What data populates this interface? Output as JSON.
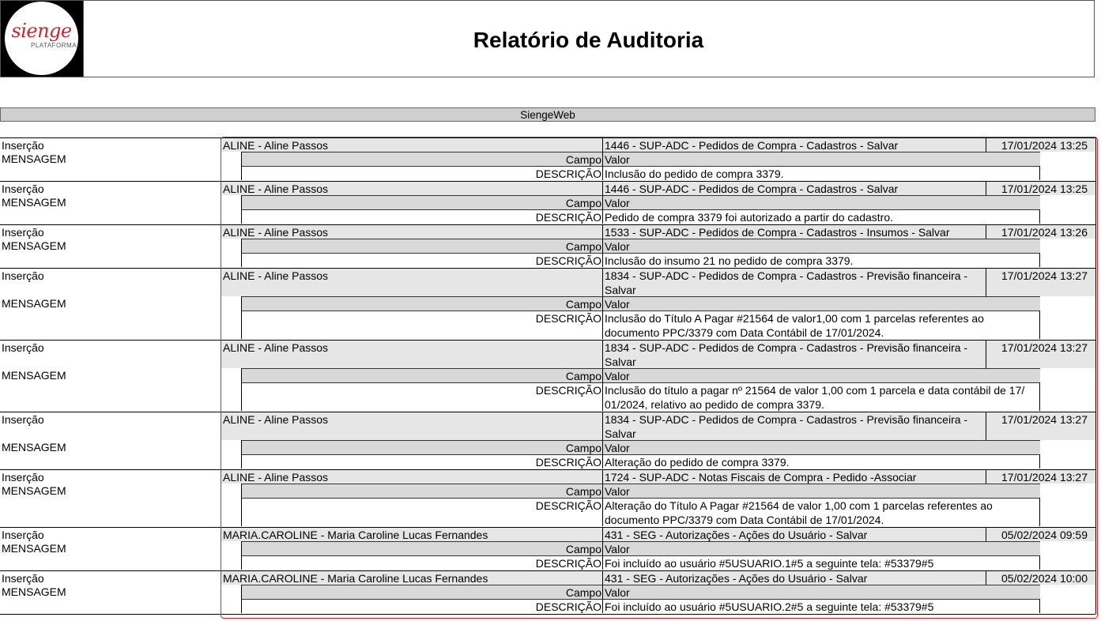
{
  "header": {
    "logo_text": "sienge",
    "logo_sub": "PLATAFORMA",
    "title": "Relatório de Auditoria"
  },
  "section_title": "SiengeWeb",
  "labels": {
    "type_label": "Inserção",
    "msg_label": "MENSAGEM",
    "campo": "Campo",
    "valor": "Valor",
    "descricao": "DESCRIÇÃO"
  },
  "records": [
    {
      "user": "ALINE - Aline Passos",
      "action": [
        "1446 - SUP-ADC - Pedidos de Compra - Cadastros - Salvar"
      ],
      "datetime": "17/01/2024 13:25",
      "desc": [
        "Inclusão do pedido de compra 3379."
      ]
    },
    {
      "user": "ALINE - Aline Passos",
      "action": [
        "1446 - SUP-ADC - Pedidos de Compra - Cadastros - Salvar"
      ],
      "datetime": "17/01/2024 13:25",
      "desc": [
        "Pedido de compra 3379 foi autorizado a partir do cadastro."
      ]
    },
    {
      "user": "ALINE - Aline Passos",
      "action": [
        "1533 - SUP-ADC - Pedidos de Compra - Cadastros - Insumos - Salvar"
      ],
      "datetime": "17/01/2024 13:26",
      "desc": [
        "Inclusão do insumo 21 no pedido de compra 3379."
      ]
    },
    {
      "user": "ALINE - Aline Passos",
      "action": [
        "1834 - SUP-ADC - Pedidos de Compra - Cadastros - Previsão financeira -",
        "Salvar"
      ],
      "datetime": "17/01/2024 13:27",
      "desc": [
        "Inclusão do Título A Pagar #21564 de valor1,00 com 1 parcelas referentes ao",
        "documento PPC/3379 com Data Contábil de 17/01/2024."
      ]
    },
    {
      "user": "ALINE - Aline Passos",
      "action": [
        "1834 - SUP-ADC - Pedidos de Compra - Cadastros - Previsão financeira -",
        "Salvar"
      ],
      "datetime": "17/01/2024 13:27",
      "desc": [
        "Inclusão do título a pagar nº 21564 de valor 1,00 com 1 parcela e data contábil de 17/",
        "01/2024, relativo ao pedido de compra 3379."
      ]
    },
    {
      "user": "ALINE - Aline Passos",
      "action": [
        "1834 - SUP-ADC - Pedidos de Compra - Cadastros - Previsão financeira -",
        "Salvar"
      ],
      "datetime": "17/01/2024 13:27",
      "desc": [
        "Alteração do pedido de compra 3379."
      ]
    },
    {
      "user": "ALINE - Aline Passos",
      "action": [
        "1724 - SUP-ADC - Notas Fiscais de Compra - Pedido -Associar"
      ],
      "datetime": "17/01/2024 13:27",
      "desc": [
        "Alteração do Título A Pagar #21564 de valor 1,00 com 1 parcelas referentes ao",
        "documento PPC/3379 com Data Contábil de 17/01/2024."
      ]
    },
    {
      "user": "MARIA.CAROLINE - Maria Caroline Lucas Fernandes",
      "action": [
        "431 - SEG - Autorizações - Ações do Usuário - Salvar"
      ],
      "datetime": "05/02/2024 09:59",
      "desc": [
        "Foi incluído ao usuário #5USUARIO.1#5 a seguinte tela: #53379#5"
      ]
    },
    {
      "user": "MARIA.CAROLINE - Maria Caroline Lucas Fernandes",
      "action": [
        "431 - SEG - Autorizações - Ações do Usuário - Salvar"
      ],
      "datetime": "05/02/2024 10:00",
      "desc": [
        "Foi incluído ao usuário #5USUARIO.2#5 a seguinte tela: #53379#5"
      ]
    }
  ]
}
